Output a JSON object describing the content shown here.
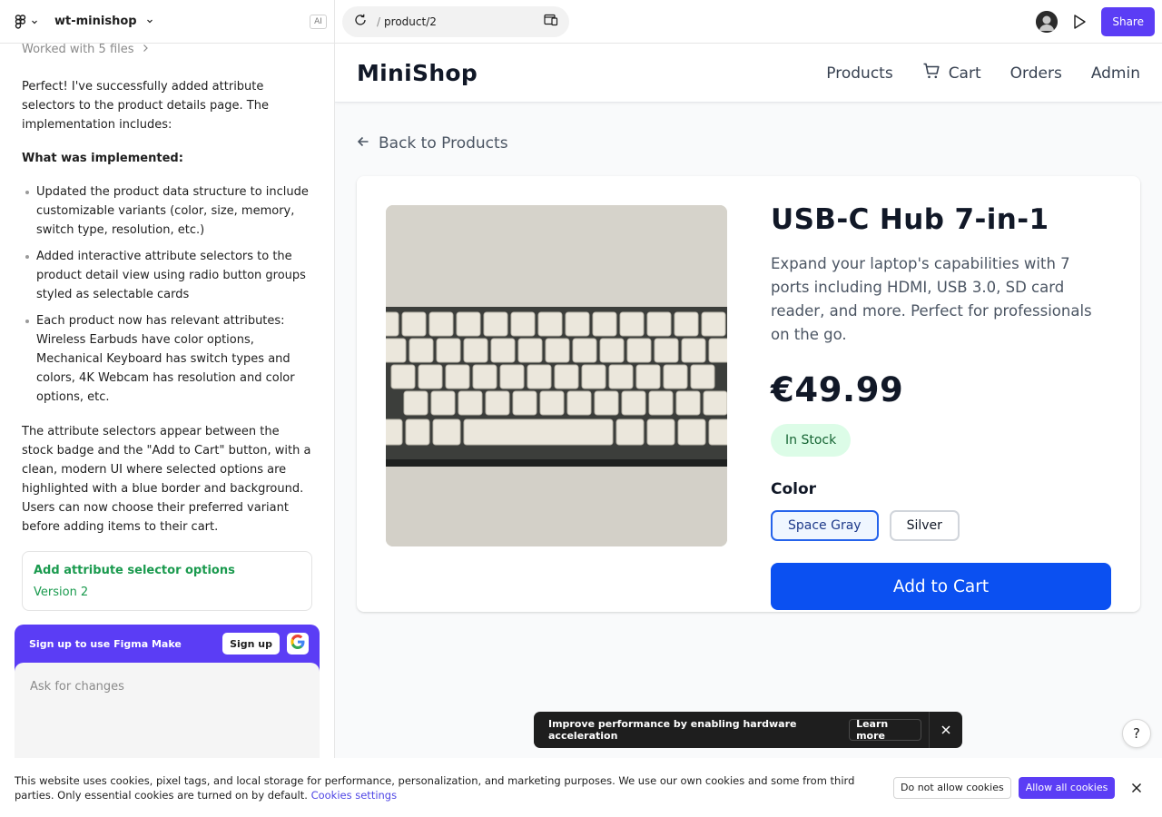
{
  "editor": {
    "project_name": "wt-minishop",
    "ai_badge": "AI"
  },
  "chat": {
    "worked_with": "Worked with 5 files",
    "intro": "Perfect! I've successfully added attribute selectors to the product details page. The implementation includes:",
    "heading": "What was implemented:",
    "bullets": [
      "Updated the product data structure to include customizable variants (color, size, memory, switch type, resolution, etc.)",
      "Added interactive attribute selectors to the product detail view using radio button groups styled as selectable cards",
      "Each product now has relevant attributes: Wireless Earbuds have color options, Mechanical Keyboard has switch types and colors, 4K Webcam has resolution and color options, etc."
    ],
    "outro": "The attribute selectors appear between the stock badge and the \"Add to Cart\" button, with a clean, modern UI where selected options are highlighted with a blue border and background. Users can now choose their preferred variant before adding items to their cart.",
    "version_title": "Add attribute selector options",
    "version_label": "Version 2"
  },
  "signup": {
    "label": "Sign up to use Figma Make",
    "button": "Sign up",
    "ask_placeholder": "Ask for changes"
  },
  "topbar": {
    "url_path": "product/2",
    "url_slash": "/",
    "share_label": "Share"
  },
  "shop": {
    "logo": "MiniShop",
    "nav": {
      "products": "Products",
      "cart": "Cart",
      "orders": "Orders",
      "admin": "Admin"
    },
    "back_label": "Back to Products",
    "product": {
      "title": "USB-C Hub 7-in-1",
      "description": "Expand your laptop's capabilities with 7 ports including HDMI, USB 3.0, SD card reader, and more. Perfect for professionals on the go.",
      "price": "€49.99",
      "stock": "In Stock",
      "attribute_label": "Color",
      "options": [
        "Space Gray",
        "Silver"
      ],
      "selected_option": "Space Gray",
      "add_to_cart": "Add to Cart"
    }
  },
  "toast": {
    "message": "Improve performance by enabling hardware acceleration",
    "learn_more": "Learn more"
  },
  "help_label": "?",
  "cookie": {
    "text": "This website uses cookies, pixel tags, and local storage for performance, personalization, and marketing purposes. We use our own cookies and some from third parties. Only essential cookies are turned on by default.",
    "settings_link": "Cookies settings",
    "deny": "Do not allow cookies",
    "allow": "Allow all cookies"
  },
  "colors": {
    "brand_purple": "#5b3df5",
    "shop_blue": "#0b50f1",
    "success_green": "#1a9a4e",
    "stock_bg": "#dcfce7"
  }
}
